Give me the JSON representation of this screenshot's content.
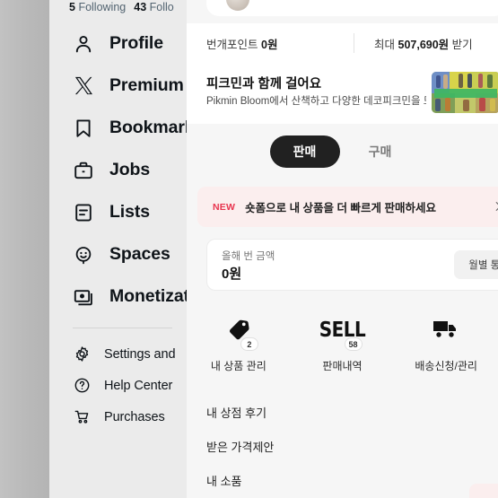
{
  "sidebar": {
    "stats": {
      "following_count": "5",
      "following_label": "Following",
      "followers_count": "43",
      "followers_label": "Follo"
    },
    "items": [
      {
        "label": "Profile",
        "icon": "person-icon"
      },
      {
        "label": "Premium",
        "icon": "x-logo-icon"
      },
      {
        "label": "Bookmarks",
        "icon": "bookmark-icon"
      },
      {
        "label": "Jobs",
        "icon": "briefcase-icon"
      },
      {
        "label": "Lists",
        "icon": "list-icon"
      },
      {
        "label": "Spaces",
        "icon": "spaces-icon"
      },
      {
        "label": "Monetization",
        "icon": "monetization-icon"
      }
    ],
    "secondary_items": [
      {
        "label": "Settings and",
        "icon": "gear-icon"
      },
      {
        "label": "Help Center",
        "icon": "help-circle-icon"
      },
      {
        "label": "Purchases",
        "icon": "cart-icon"
      }
    ]
  },
  "panel": {
    "points": {
      "label": "번개포인트",
      "value": "0원",
      "offer_prefix": "최대",
      "offer_amount": "507,690원",
      "offer_suffix": "받기"
    },
    "promo": {
      "title": "피크민과 함께 걸어요",
      "subtitle": "Pikmin Bloom에서 산책하고 다양한 데코피크민을 모...",
      "thumbnail": "pikmin-collage-thumbnail"
    },
    "segment": {
      "options": [
        {
          "label": "판매",
          "active": true
        },
        {
          "label": "구매",
          "active": false
        }
      ]
    },
    "new_banner": {
      "tag": "NEW",
      "text": "숏폼으로 내 상품을 더 빠르게 판매하세요",
      "chevron": "chevron-right-icon"
    },
    "amount_card": {
      "label": "올해 번 금액",
      "value": "0원",
      "stats_button": "월별 통계"
    },
    "quick_menu": [
      {
        "label": "내 상품 관리",
        "badge": "2",
        "icon": "price-tag-icon"
      },
      {
        "label": "판매내역",
        "badge": "58",
        "icon": "sell-text-icon"
      },
      {
        "label": "배송신청/관리",
        "badge": "",
        "icon": "truck-icon"
      }
    ],
    "list_rows": [
      {
        "label": "내 상점 후기"
      },
      {
        "label": "받은 가격제안"
      },
      {
        "label": "내 소품"
      }
    ]
  },
  "colors": {
    "accent_dark": "#212121",
    "banner_bg": "#fbeeee",
    "banner_red": "#e8344e",
    "panel_bg": "#f6f6f6",
    "sidebar_bg": "#ebebeb",
    "dim_strip": "#b9b9b9"
  }
}
